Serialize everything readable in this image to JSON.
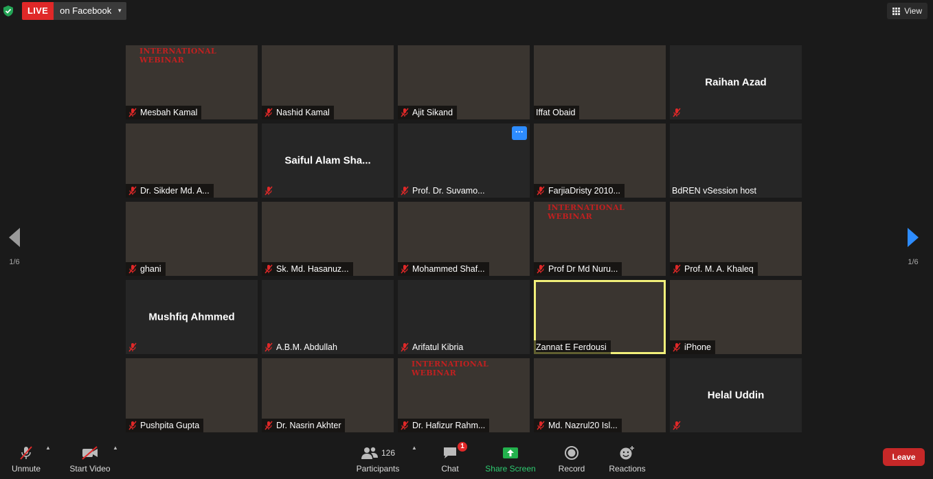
{
  "top": {
    "live_label": "LIVE",
    "live_destination": "on Facebook",
    "view_label": "View"
  },
  "nav": {
    "left_page": "1/6",
    "right_page": "1/6"
  },
  "tiles": [
    {
      "name": "Mesbah Kamal",
      "type": "video",
      "bg": "bg1",
      "overlay": "INTERNATIONAL WEBINAR",
      "muted": true
    },
    {
      "name": "Nashid Kamal",
      "type": "video",
      "bg": "bg2",
      "muted": true
    },
    {
      "name": "Ajit Sikand",
      "type": "video",
      "bg": "bg3",
      "muted": true
    },
    {
      "name": "Iffat Obaid",
      "type": "video",
      "bg": "bg4",
      "muted": false
    },
    {
      "name": "",
      "type": "avatar",
      "big": "Raihan Azad",
      "muted": true
    },
    {
      "name": "Dr. Sikder Md. A...",
      "type": "video",
      "bg": "bg5",
      "muted": true
    },
    {
      "name": "",
      "type": "avatar",
      "big": "Saiful  Alam  Sha...",
      "muted": true
    },
    {
      "name": "Prof. Dr. Suvamo...",
      "type": "avatar",
      "big": "",
      "muted": true,
      "more": true
    },
    {
      "name": "FarjiaDristy 2010...",
      "type": "video",
      "bg": "bg6",
      "muted": true
    },
    {
      "name": "BdREN vSession host",
      "type": "avatar",
      "big": "",
      "muted": false
    },
    {
      "name": "ghani",
      "type": "video",
      "bg": "bg7",
      "muted": true
    },
    {
      "name": "Sk. Md. Hasanuz...",
      "type": "video",
      "bg": "bg8",
      "muted": true
    },
    {
      "name": "Mohammed Shaf...",
      "type": "video",
      "bg": "bg9",
      "muted": true
    },
    {
      "name": "Prof Dr Md Nuru...",
      "type": "video",
      "bg": "bg10",
      "overlay": "INTERNATIONAL WEBINAR",
      "muted": true
    },
    {
      "name": "Prof. M. A. Khaleq",
      "type": "video",
      "bg": "bg11",
      "muted": true
    },
    {
      "name": "",
      "type": "avatar",
      "big": "Mushfiq Ahmmed",
      "muted": true
    },
    {
      "name": "A.B.M. Abdullah",
      "type": "avatar",
      "big": "",
      "muted": true
    },
    {
      "name": "Arifatul Kibria",
      "type": "avatar",
      "big": "",
      "muted": true
    },
    {
      "name": "Zannat E Ferdousi",
      "type": "video",
      "bg": "bg12",
      "muted": false,
      "active": true
    },
    {
      "name": "iPhone",
      "type": "video",
      "bg": "bg13",
      "muted": true
    },
    {
      "name": "Pushpita Gupta",
      "type": "video",
      "bg": "bg14",
      "muted": true
    },
    {
      "name": "Dr. Nasrin Akhter",
      "type": "video",
      "bg": "bg15",
      "muted": true
    },
    {
      "name": "Dr. Hafizur Rahm...",
      "type": "video",
      "bg": "bg16",
      "overlay": "INTERNATIONAL WEBINAR",
      "muted": true
    },
    {
      "name": "Md. Nazrul20 Isl...",
      "type": "video",
      "bg": "bg17",
      "muted": true
    },
    {
      "name": "",
      "type": "avatar",
      "big": "Helal Uddin",
      "muted": true
    }
  ],
  "toolbar": {
    "unmute": "Unmute",
    "start_video": "Start Video",
    "participants": "Participants",
    "participants_count": "126",
    "chat": "Chat",
    "chat_badge": "1",
    "share_screen": "Share Screen",
    "record": "Record",
    "reactions": "Reactions",
    "leave": "Leave"
  },
  "colors": {
    "live_red": "#e02828",
    "share_green": "#2ecc71",
    "active_speaker": "#f2f07a",
    "accent_blue": "#2d8cff",
    "leave_red": "#c62828"
  }
}
